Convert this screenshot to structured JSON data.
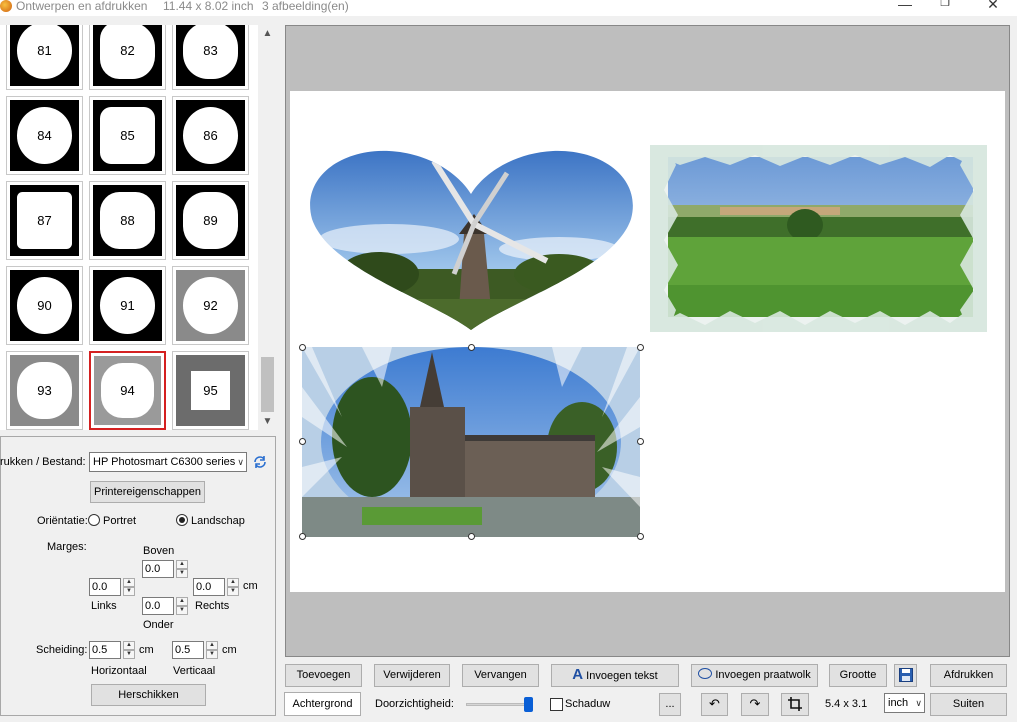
{
  "window": {
    "title": "Ontwerpen en afdrukken",
    "size_label": "11.44 x 8.02 inch",
    "count_label": "3 afbeelding(en)",
    "minimize": "—",
    "maximize": "❐",
    "close": "✕"
  },
  "thumbnails": [
    {
      "num": "81"
    },
    {
      "num": "82"
    },
    {
      "num": "83"
    },
    {
      "num": "84"
    },
    {
      "num": "85"
    },
    {
      "num": "86"
    },
    {
      "num": "87"
    },
    {
      "num": "88"
    },
    {
      "num": "89"
    },
    {
      "num": "90"
    },
    {
      "num": "91"
    },
    {
      "num": "92"
    },
    {
      "num": "93"
    },
    {
      "num": "94"
    },
    {
      "num": "95"
    }
  ],
  "selected_thumbnail": "94",
  "settings": {
    "printer_label": "rukken / Bestand:",
    "printer_value": "HP Photosmart C6300 series",
    "printer_props_button": "Printereigenschappen",
    "orientation_label": "Oriëntatie:",
    "portrait_label": "Portret",
    "landscape_label": "Landschap",
    "orientation_selected": "Landschap",
    "margins_label": "Marges:",
    "top_label": "Boven",
    "top_value": "0.0",
    "left_value": "0.0",
    "left_label": "Links",
    "right_value": "0.0",
    "right_label": "Rechts",
    "bottom_value": "0.0",
    "bottom_label": "Onder",
    "unit": "cm",
    "spacing_label": "Scheiding:",
    "horizontal_value": "0.5",
    "horizontal_label": "Horizontaal",
    "vertical_value": "0.5",
    "vertical_label": "Verticaal",
    "rearrange_button": "Herschikken"
  },
  "toolbar": {
    "add": "Toevoegen",
    "remove": "Verwijderen",
    "replace": "Vervangen",
    "insert_text": "Invoegen tekst",
    "insert_bubble": "Invoegen praatwolk",
    "size": "Grootte",
    "print": "Afdrukken",
    "background": "Achtergrond",
    "opacity_label": "Doorzichtigheid:",
    "opacity_level": 0.95,
    "shadow_label": "Schaduw",
    "more": "...",
    "size_readout": "5.4 x 3.1",
    "unit_value": "inch",
    "fit": "Suiten"
  },
  "colors": {
    "accent": "#0a5fd6",
    "selection": "#d42020",
    "canvas_bg": "#bebebe"
  }
}
